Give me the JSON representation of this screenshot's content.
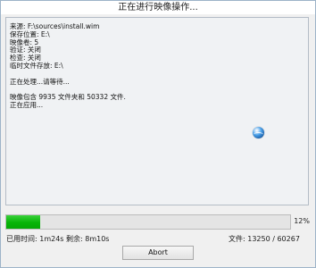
{
  "window": {
    "title": "正在进行映像操作..."
  },
  "log": {
    "lines": [
      "来源: F:\\sources\\install.wim",
      "保存位置: E:\\",
      "映像卷: 5",
      "验证: 关闭",
      "检查: 关闭",
      "临时文件存放: E:\\",
      "",
      "正在处理...请等待...",
      "",
      "映像包含 9935 文件夹和 50332 文件.",
      "正在应用..."
    ]
  },
  "progress": {
    "fraction": 0.12,
    "percent_label": "12%"
  },
  "status": {
    "elapsed": "已用时间:  1m24s",
    "remaining": "剩余:  8m10s",
    "files": "文件: 13250 / 60267"
  },
  "buttons": {
    "abort_label": "Abort"
  },
  "colors": {
    "progress_fill": "#06b206",
    "spinner": "#2f7fd0"
  },
  "icons": {
    "spinner": "busy-globe-icon"
  }
}
